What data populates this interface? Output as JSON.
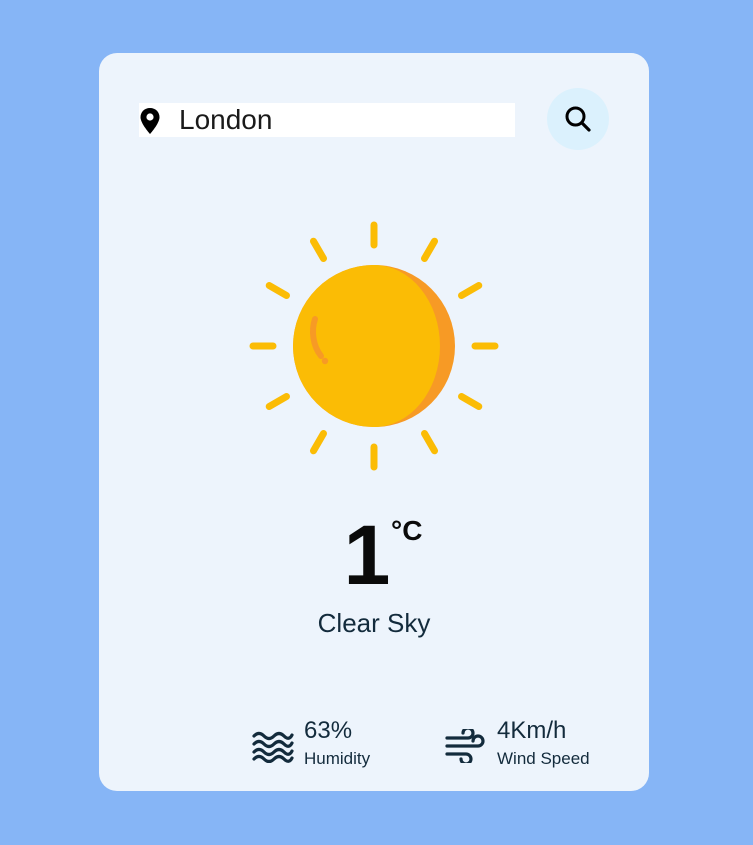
{
  "search": {
    "value": "London",
    "location_icon": "map-pin-icon",
    "button_icon": "search-icon"
  },
  "weather": {
    "icon": "sun-icon",
    "temperature": "1",
    "unit": "°C",
    "condition": "Clear Sky"
  },
  "stats": {
    "humidity": {
      "icon": "waves-icon",
      "value": "63%",
      "label": "Humidity"
    },
    "wind": {
      "icon": "wind-icon",
      "value": "4Km/h",
      "label": "Wind Speed"
    }
  },
  "colors": {
    "page_background": "#86b5f6",
    "card_background": "#edf4fc",
    "search_button_background": "#dbf1fd",
    "sun_main": "#fbbc05",
    "sun_shade": "#f79a25",
    "text_dark": "#132b3c"
  }
}
